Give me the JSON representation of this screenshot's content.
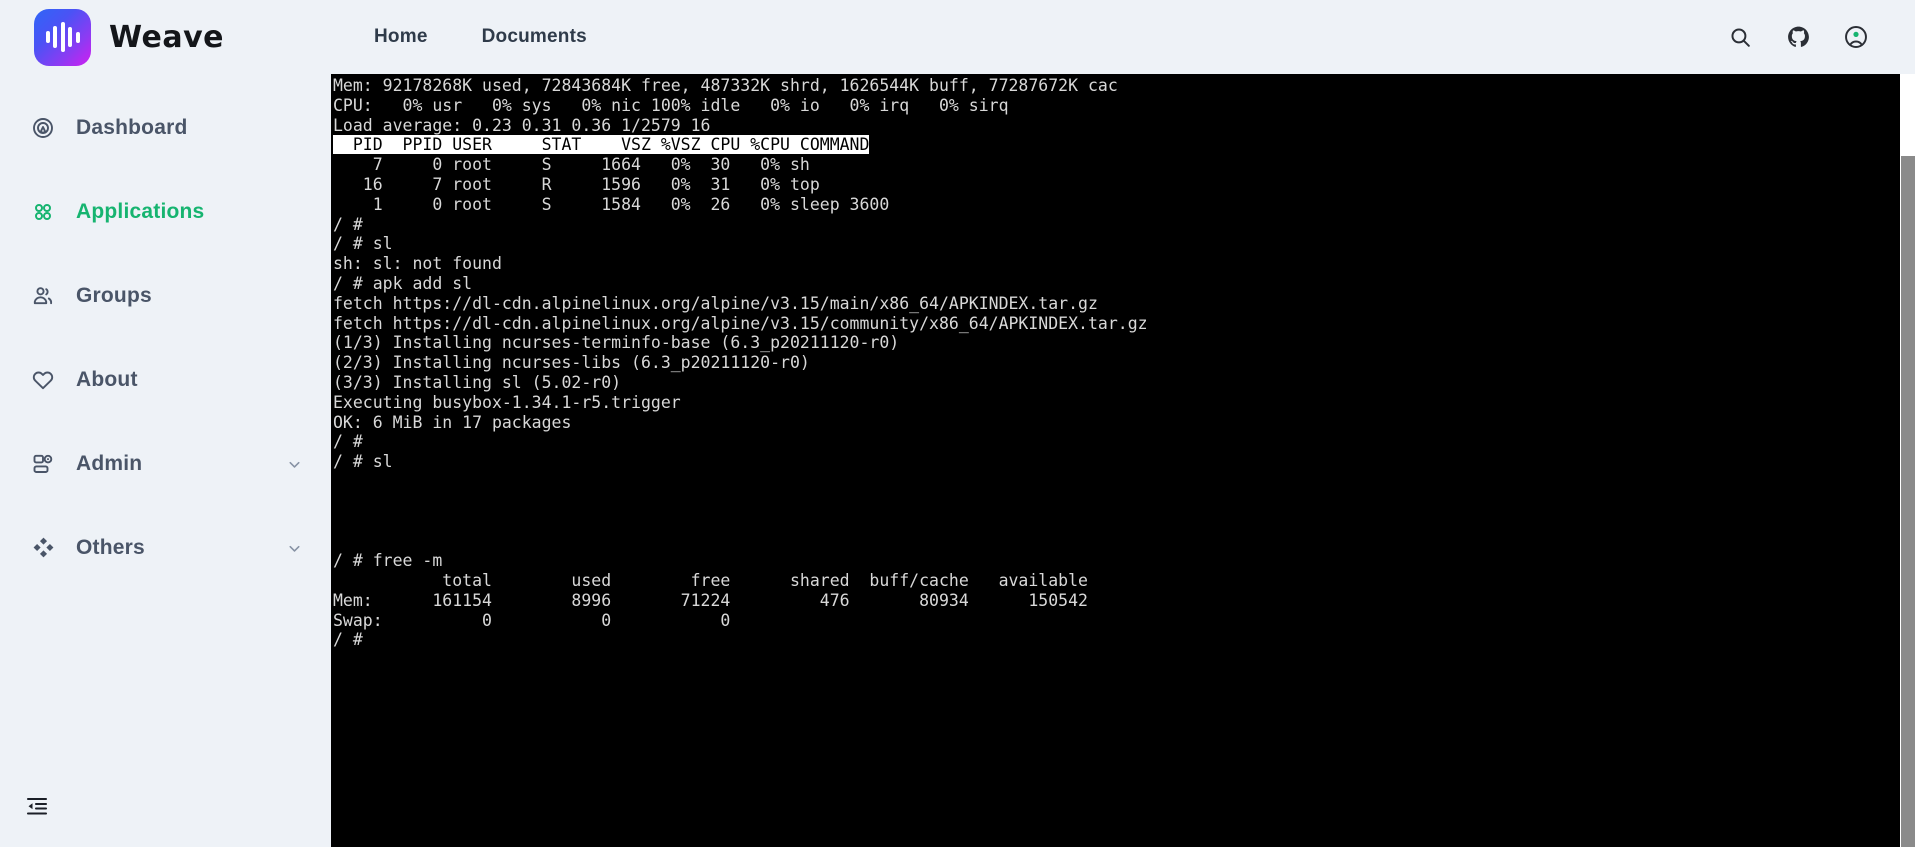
{
  "header": {
    "brand_name": "Weave",
    "logo_icon": "waveform-logo-icon",
    "logo_gradient_from": "#2f66f7",
    "logo_gradient_to": "#cf1ff0",
    "nav": [
      {
        "label": "Home",
        "name": "nav-link-home"
      },
      {
        "label": "Documents",
        "name": "nav-link-documents"
      }
    ],
    "actions": [
      {
        "name": "search-icon",
        "title": "Search"
      },
      {
        "name": "github-icon",
        "title": "GitHub"
      },
      {
        "name": "account-icon",
        "title": "Account"
      }
    ]
  },
  "sidebar": {
    "active_item": "Applications",
    "active_color": "#16b470",
    "items": [
      {
        "label": "Dashboard",
        "icon": "dashboard-icon",
        "active": false,
        "expandable": false
      },
      {
        "label": "Applications",
        "icon": "applications-icon",
        "active": true,
        "expandable": false
      },
      {
        "label": "Groups",
        "icon": "groups-icon",
        "active": false,
        "expandable": false
      },
      {
        "label": "About",
        "icon": "heart-icon",
        "active": false,
        "expandable": false
      },
      {
        "label": "Admin",
        "icon": "admin-icon",
        "active": false,
        "expandable": true
      },
      {
        "label": "Others",
        "icon": "diamonds-icon",
        "active": false,
        "expandable": true
      }
    ],
    "collapse_button": {
      "name": "collapse-sidebar-button",
      "icon": "indent-decrease-icon"
    }
  },
  "terminal": {
    "background": "#000000",
    "foreground": "#d8d8d8",
    "lines": [
      {
        "text": "Mem: 92178268K used, 72843684K free, 487332K shrd, 1626544K buff, 77287672K cac",
        "inverted": false
      },
      {
        "text": "CPU:   0% usr   0% sys   0% nic 100% idle   0% io   0% irq   0% sirq",
        "inverted": false
      },
      {
        "text": "Load average: 0.23 0.31 0.36 1/2579 16",
        "inverted": false
      },
      {
        "text": "  PID  PPID USER     STAT    VSZ %VSZ CPU %CPU COMMAND",
        "inverted": true
      },
      {
        "text": "    7     0 root     S     1664   0%  30   0% sh",
        "inverted": false
      },
      {
        "text": "   16     7 root     R     1596   0%  31   0% top",
        "inverted": false
      },
      {
        "text": "    1     0 root     S     1584   0%  26   0% sleep 3600",
        "inverted": false
      },
      {
        "text": "/ #",
        "inverted": false
      },
      {
        "text": "/ # sl",
        "inverted": false
      },
      {
        "text": "sh: sl: not found",
        "inverted": false
      },
      {
        "text": "/ # apk add sl",
        "inverted": false
      },
      {
        "text": "fetch https://dl-cdn.alpinelinux.org/alpine/v3.15/main/x86_64/APKINDEX.tar.gz",
        "inverted": false
      },
      {
        "text": "fetch https://dl-cdn.alpinelinux.org/alpine/v3.15/community/x86_64/APKINDEX.tar.gz",
        "inverted": false
      },
      {
        "text": "(1/3) Installing ncurses-terminfo-base (6.3_p20211120-r0)",
        "inverted": false
      },
      {
        "text": "(2/3) Installing ncurses-libs (6.3_p20211120-r0)",
        "inverted": false
      },
      {
        "text": "(3/3) Installing sl (5.02-r0)",
        "inverted": false
      },
      {
        "text": "Executing busybox-1.34.1-r5.trigger",
        "inverted": false
      },
      {
        "text": "OK: 6 MiB in 17 packages",
        "inverted": false
      },
      {
        "text": "/ #",
        "inverted": false
      },
      {
        "text": "/ # sl",
        "inverted": false
      },
      {
        "text": "",
        "inverted": false
      },
      {
        "text": "",
        "inverted": false
      },
      {
        "text": "",
        "inverted": false
      },
      {
        "text": "",
        "inverted": false
      },
      {
        "text": "/ # free -m",
        "inverted": false
      },
      {
        "text": "           total        used        free      shared  buff/cache   available",
        "inverted": false
      },
      {
        "text": "Mem:      161154        8996       71224         476       80934      150542",
        "inverted": false
      },
      {
        "text": "Swap:          0           0           0",
        "inverted": false
      },
      {
        "text": "/ #",
        "inverted": false
      }
    ]
  },
  "scrollbar": {
    "name": "terminal-scrollbar",
    "track_color": "#ffffff",
    "thumb_color": "#8a8a8a"
  }
}
